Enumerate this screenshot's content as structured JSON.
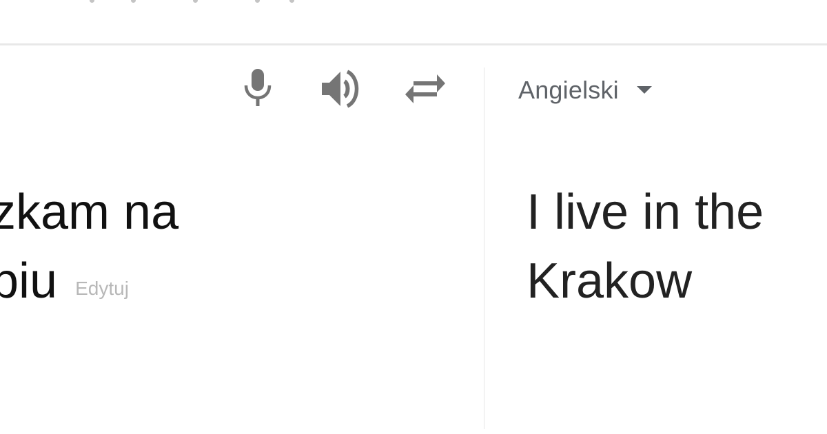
{
  "source": {
    "line1": "zkam na",
    "line2": "piu",
    "edit_label": "Edytuj"
  },
  "target": {
    "language": "Angielski",
    "line1": "I live in the",
    "line2": "Krakow"
  },
  "toolbar": {
    "icons": [
      "microphone-icon",
      "speaker-icon",
      "swap-languages-icon"
    ]
  },
  "colors": {
    "icon": "#757575",
    "divider": "#e6e6e6",
    "text": "#111111",
    "muted": "#b8b8b8"
  }
}
